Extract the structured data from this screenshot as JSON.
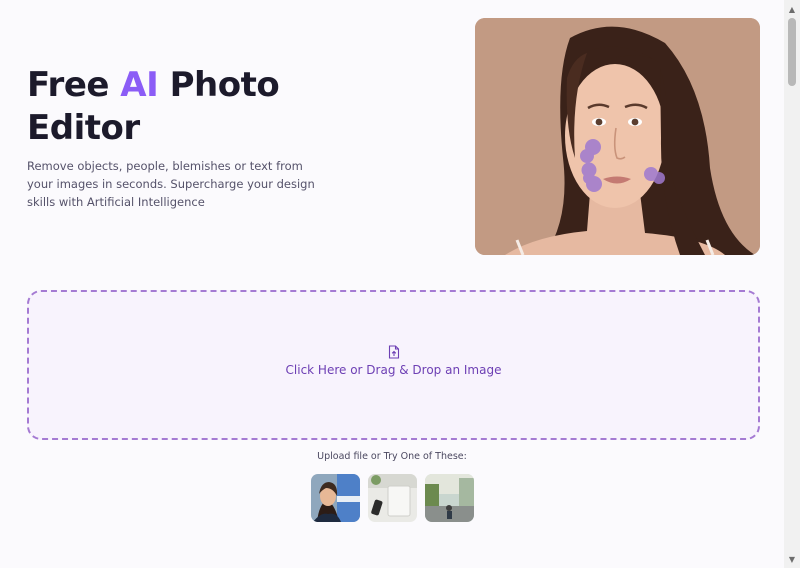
{
  "hero": {
    "title_part1": "Free ",
    "title_accent": "AI",
    "title_part2": " Photo Editor",
    "description": "Remove objects, people, blemishes or text from your images in seconds. Supercharge your design skills with Artificial Intelligence",
    "image_alt_icon": "woman-portrait-image"
  },
  "upload": {
    "icon": "file-upload-icon",
    "label": "Click Here or Drag & Drop an Image"
  },
  "samples": {
    "label": "Upload file or Try One of These:",
    "items": [
      "sample-portrait",
      "sample-phone-desk",
      "sample-street-scene"
    ]
  },
  "colors": {
    "accent": "#8b5cf6",
    "dropzone_border": "#a57ad3",
    "dropzone_bg": "#f8f3fd",
    "dropzone_text": "#6d3fb4"
  }
}
